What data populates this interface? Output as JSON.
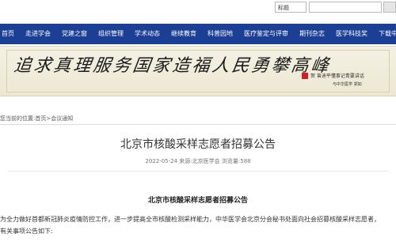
{
  "topbar": {
    "search_scope": "标题"
  },
  "nav": {
    "items": [
      "首页",
      "走进学会",
      "党建之窗",
      "组织管理",
      "学术动态",
      "继续教育",
      "科普园地",
      "医疗鉴定与评审",
      "期刊杂志",
      "医学科技奖",
      "下载中心"
    ]
  },
  "banner": {
    "calligraphy": "追求真理服务国家造福人民勇攀高峰",
    "subtitle_line1": "贺 曾迪平懂事记青要讲话",
    "subtitle_line2": "与中华医学  郑如"
  },
  "breadcrumb": {
    "prefix": "您当前的位置:",
    "home": "首页",
    "separator": ">",
    "section": "会议通知"
  },
  "article": {
    "title": "北京市核酸采样志愿者招募公告",
    "date": "2022-05-24",
    "source": "来源:北京医学会",
    "views_label": "浏览量:",
    "views": "588",
    "heading": "北京市核酸采样志愿者招募公告",
    "paragraph_line1": "为全力做好首都新冠肺炎疫情防控工作，进一步提高全市核酸检测采样能力，中华医学会北京分会秘书处面向社会招募核酸采样志愿者，",
    "paragraph_line2": "有关事项公告如下:"
  }
}
